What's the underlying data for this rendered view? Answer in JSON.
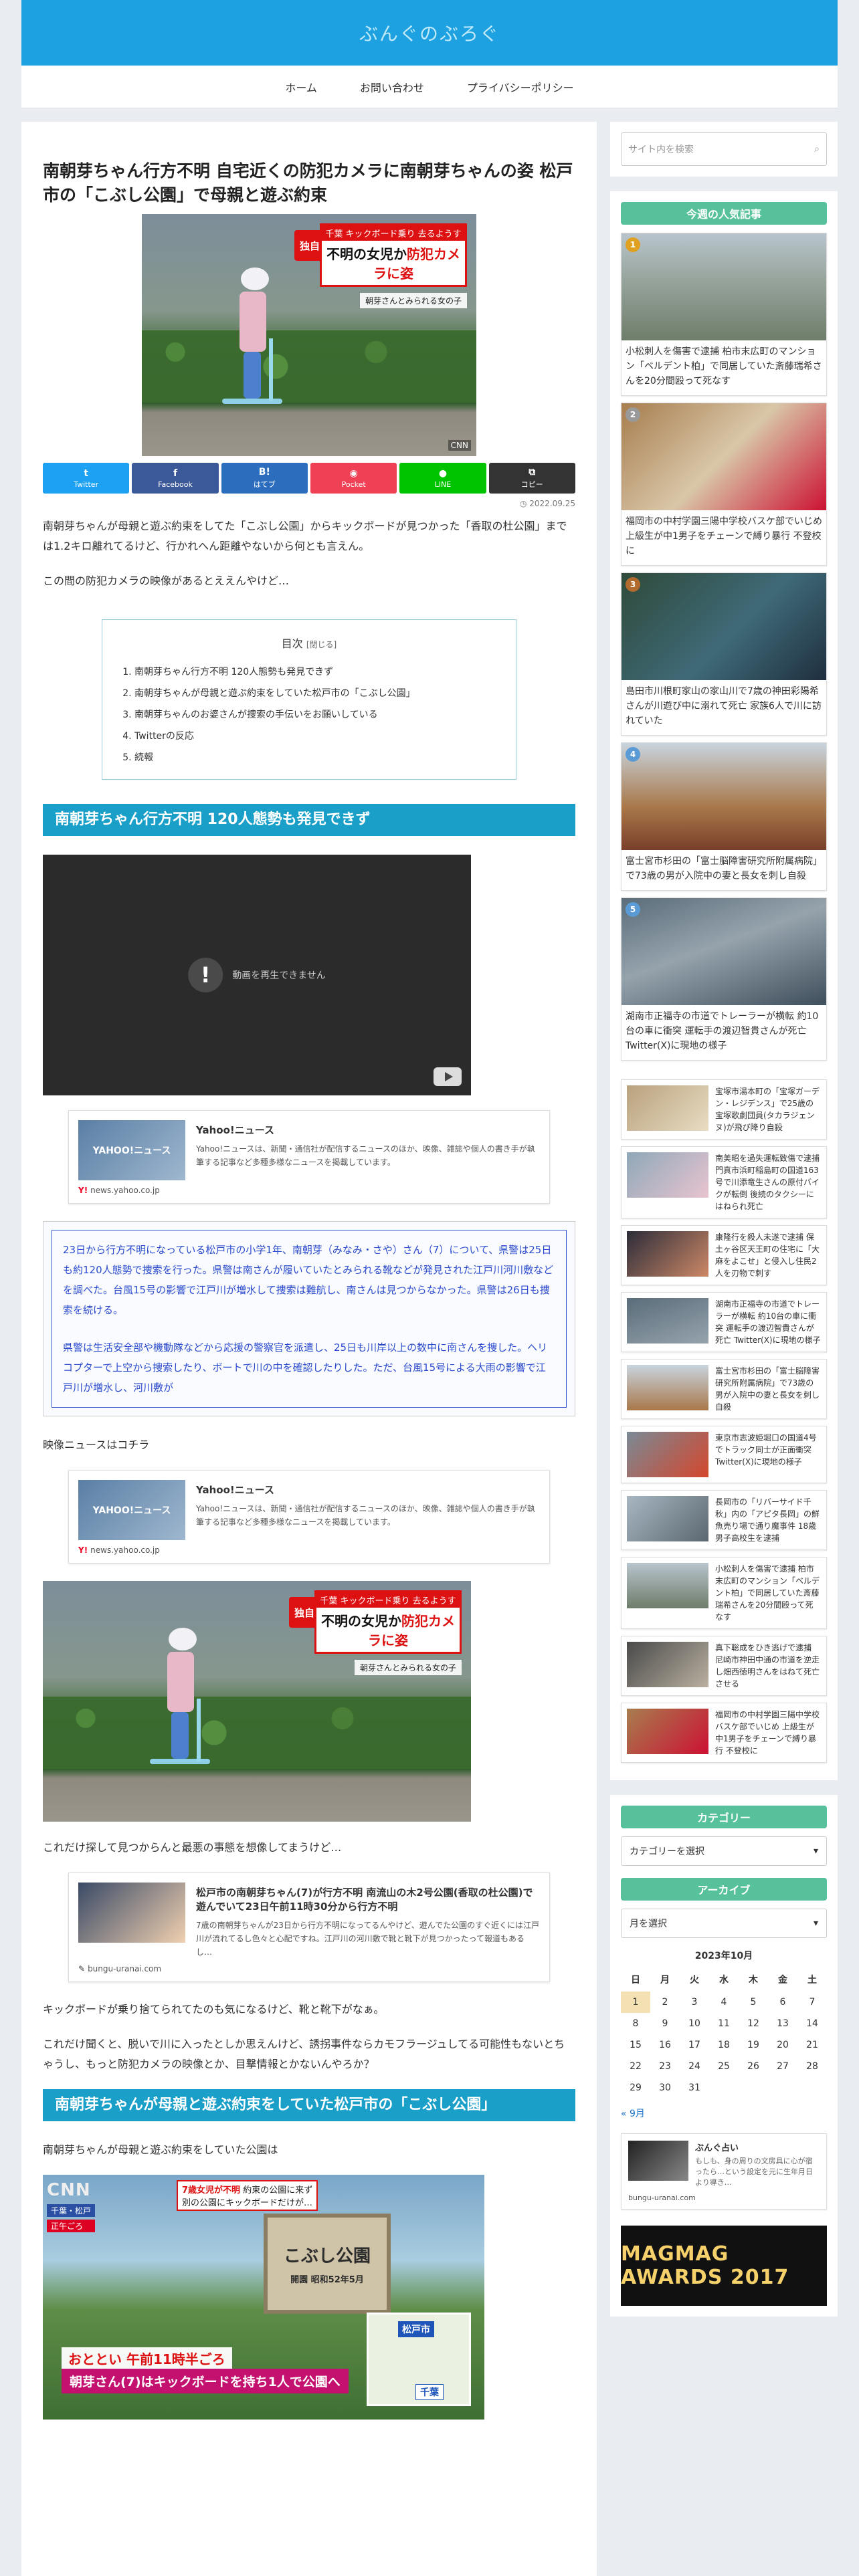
{
  "site": {
    "title": "ぶんぐのぶろぐ"
  },
  "nav": [
    {
      "label": "ホーム"
    },
    {
      "label": "お問い合わせ"
    },
    {
      "label": "プライバシーポリシー"
    }
  ],
  "article": {
    "title": "南朝芽ちゃん行方不明 自宅近くの防犯カメラに南朝芽ちゃんの姿 松戸市の「こぶし公園」で母親と遊ぶ約束",
    "hero": {
      "dokuji": "独自",
      "banner_top": "千葉 キックボード乗り 去るようす",
      "banner_main_a": "不明の女児か",
      "banner_main_b": "防犯カメラに姿",
      "caption": "朝芽さんとみられる女の子",
      "tv": "CNN"
    },
    "share": [
      {
        "icon": "t",
        "label": "Twitter",
        "color": "#1da1f2"
      },
      {
        "icon": "f",
        "label": "Facebook",
        "color": "#3b5998"
      },
      {
        "icon": "B!",
        "label": "はてブ",
        "color": "#2c6ebd"
      },
      {
        "icon": "◉",
        "label": "Pocket",
        "color": "#ef4056"
      },
      {
        "icon": "●",
        "label": "LINE",
        "color": "#00c300"
      },
      {
        "icon": "⧉",
        "label": "コピー",
        "color": "#333333"
      }
    ],
    "date": "2022.09.25",
    "p1": "南朝芽ちゃんが母親と遊ぶ約束をしてた「こぶし公園」からキックボードが見つかった「香取の杜公園」までは1.2キロ離れてるけど、行かれへん距離やないから何とも言えん。",
    "p2": "この間の防犯カメラの映像があるとええんやけど…",
    "toc": {
      "title": "目次",
      "toggle": "[閉じる]",
      "items": [
        "南朝芽ちゃん行方不明 120人態勢も発見できず",
        "南朝芽ちゃんが母親と遊ぶ約束をしていた松戸市の「こぶし公園」",
        "南朝芽ちゃんのお婆さんが捜索の手伝いをお願いしている",
        "Twitterの反応",
        "続報"
      ]
    },
    "h2_1": "南朝芽ちゃん行方不明 120人態勢も発見できず",
    "video_error": "動画を再生できません",
    "yahoo_card": {
      "thumb": "YAHOO!ニュース",
      "title": "Yahoo!ニュース",
      "desc": "Yahoo!ニュースは、新聞・通信社が配信するニュースのほか、映像、雑誌や個人の書き手が執筆する記事など多種多様なニュースを掲載しています。",
      "url": "news.yahoo.co.jp"
    },
    "quote_p1": "23日から行方不明になっている松戸市の小学1年、南朝芽（みなみ・さや）さん（7）について、県警は25日も約120人態勢で捜索を行った。県警は南さんが履いていたとみられる靴などが発見された江戸川河川敷などを調べた。台風15号の影響で江戸川が増水して捜索は難航し、南さんは見つからなかった。県警は26日も捜索を続ける。",
    "quote_p2": "県警は生活安全部や機動隊などから応援の警察官を派遣し、25日も川岸以上の数中に南さんを捜した。ヘリコプターで上空から捜索したり、ボートで川の中を確認したりした。ただ、台風15号による大雨の影響で江戸川が増水し、河川敷が",
    "p3": "映像ニュースはコチラ",
    "p4": "これだけ探して見つからんと最悪の事態を想像してまうけど…",
    "card2": {
      "title": "松戸市の南朝芽ちゃん(7)が行方不明 南流山の木2号公園(香取の杜公園)で遊んでいて23日午前11時30分から行方不明",
      "desc": "7歳の南朝芽ちゃんが23日から行方不明になってるんやけど、遊んでた公園のすぐ近くには江戸川が流れてるし色々と心配ですね。江戸川の河川敷で靴と靴下が見つかったって報道もあるし…",
      "url": "bungu-uranai.com"
    },
    "p5": "キックボードが乗り捨てられてたのも気になるけど、靴と靴下がなぁ。",
    "p6": "これだけ聞くと、脱いで川に入ったとしか思えんけど、誘拐事件ならカモフラージュしてる可能性もないとちゃうし、もっと防犯カメラの映像とか、目撃情報とかないんやろか？",
    "h2_2": "南朝芽ちゃんが母親と遊ぶ約束をしていた松戸市の「こぶし公園」",
    "p7": "南朝芽ちゃんが母親と遊ぶ約束をしていた公園は",
    "park": {
      "cnn": "CNN",
      "loc": "千葉・松戸",
      "loc2": "正午ごろ",
      "title_a": "7歳女児が不明",
      "title_b": "約束の公園に来ず",
      "title_c": "別の公園にキックボードだけが…",
      "sign": "こぶし公園",
      "sign_small": "開園 昭和52年5月",
      "map_a": "松戸市",
      "map_b": "千葉",
      "bot1": "おととい 午前11時半ごろ",
      "bot2": "朝芽さん(7)はキックボードを持ち1人で公園へ"
    }
  },
  "sidebar": {
    "search_placeholder": "サイト内を検索",
    "weekly_title": "今週の人気記事",
    "rank": [
      {
        "n": "1",
        "text": "小松刺人を傷害で逮捕 柏市末広町のマンション「ベルデント柏」で同居していた斎藤瑞希さんを20分間殴って死なす",
        "badge": "#e0a020"
      },
      {
        "n": "2",
        "text": "福岡市の中村学園三陽中学校バスケ部でいじめ 上級生が中1男子をチェーンで縛り暴行 不登校に",
        "badge": "#999999"
      },
      {
        "n": "3",
        "text": "島田市川根町家山の家山川で7歳の神田彩陽希さんが川遊び中に溺れて死亡 家族6人で川に訪れていた",
        "badge": "#b26b2e"
      },
      {
        "n": "4",
        "text": "富士宮市杉田の「富士脳障害研究所附属病院」で73歳の男が入院中の妻と長女を刺し自殺",
        "badge": "#5b9bd5"
      },
      {
        "n": "5",
        "text": "湖南市正福寺の市道でトレーラーが横転 約10台の車に衝突 運転手の渡辺智貴さんが死亡 Twitter(X)に現地の様子",
        "badge": "#5b9bd5"
      }
    ],
    "mini": [
      "宝塚市湯本町の「宝塚ガーデン・レジデンス」で25歳の宝塚歌劇団員(タカラジェンヌ)が飛び降り自殺",
      "南美昭を過失運転致傷で逮捕 門真市浜町稲島町の国道163号で川添竜生さんの原付バイクが転倒 後続のタクシーにはねられ死亡",
      "康隆行を殺人未遂で逮捕 保土ヶ谷区天王町の住宅に「大麻をよこせ」と侵入し住民2人を刃物で刺す",
      "湖南市正福寺の市道でトレーラーが横転 約10台の車に衝突 運転手の渡辺智貴さんが死亡 Twitter(X)に現地の様子",
      "富士宮市杉田の「富士脳障害研究所附属病院」で73歳の男が入院中の妻と長女を刺し自殺",
      "東京市志波姫堀口の国道4号でトラック同士が正面衝突 Twitter(X)に現地の様子",
      "長岡市の「リバーサイド千秋」内の「アピタ長岡」の鮮魚売り場で通り魔事件 18歳男子高校生を逮捕",
      "小松刺人を傷害で逮捕 柏市末広町のマンション「ベルデント柏」で同居していた斎藤瑞希さんを20分間殴って死なす",
      "真下聡成をひき逃げで逮捕 尼崎市神田中通の市道を逆走し畑西徳明さんをはねて死亡させる",
      "福岡市の中村学園三陽中学校バスケ部でいじめ 上級生が中1男子をチェーンで縛り暴行 不登校に"
    ],
    "category_title": "カテゴリー",
    "category_select": "カテゴリーを選択",
    "archive_title": "アーカイブ",
    "archive_select": "月を選択",
    "calendar": {
      "title": "2023年10月",
      "days": [
        "日",
        "月",
        "火",
        "水",
        "木",
        "金",
        "土"
      ],
      "weeks": [
        [
          "1",
          "2",
          "3",
          "4",
          "5",
          "6",
          "7"
        ],
        [
          "8",
          "9",
          "10",
          "11",
          "12",
          "13",
          "14"
        ],
        [
          "15",
          "16",
          "17",
          "18",
          "19",
          "20",
          "21"
        ],
        [
          "22",
          "23",
          "24",
          "25",
          "26",
          "27",
          "28"
        ],
        [
          "29",
          "30",
          "31",
          "",
          "",
          "",
          ""
        ]
      ],
      "prev": "« 9月"
    },
    "bcard": {
      "title": "ぶんぐ占い",
      "desc": "もしも、身の周りの文房具に心が宿ったら…という設定を元に生年月日より導き…",
      "url": "bungu-uranai.com"
    },
    "mag": "MAGMAG AWARDS 2017"
  }
}
